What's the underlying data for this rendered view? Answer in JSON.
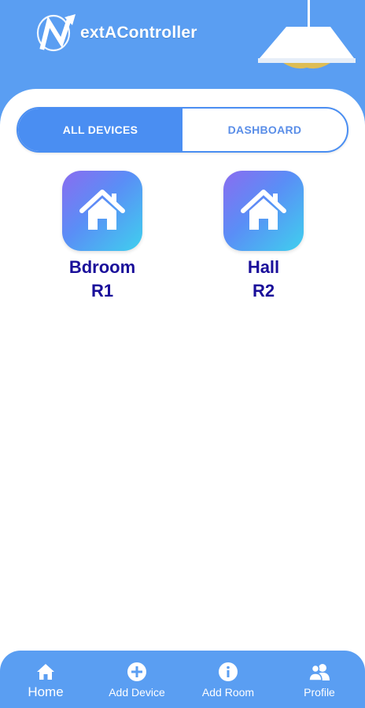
{
  "app": {
    "logo_text": "extAController",
    "logo_letter": "N"
  },
  "tabs": [
    {
      "label": "ALL DEVICES",
      "active": true
    },
    {
      "label": "DASHBOARD",
      "active": false
    }
  ],
  "devices": [
    {
      "name": "Bdroom",
      "room": "R1",
      "icon": "house-icon"
    },
    {
      "name": "Hall",
      "room": "R2",
      "icon": "house-icon"
    }
  ],
  "bottom_nav": [
    {
      "label": "Home",
      "icon": "home-icon",
      "active": true
    },
    {
      "label": "Add Device",
      "icon": "plus-circle-icon",
      "active": false
    },
    {
      "label": "Add Room",
      "icon": "info-circle-icon",
      "active": false
    },
    {
      "label": "Profile",
      "icon": "users-icon",
      "active": false
    }
  ],
  "colors": {
    "header": "#5a9ef2",
    "tab_active": "#4a8ef2",
    "device_text": "#1a0f9a",
    "tile_gradient": [
      "#8a6cf0",
      "#5a8ef6",
      "#3fd0ee"
    ]
  }
}
